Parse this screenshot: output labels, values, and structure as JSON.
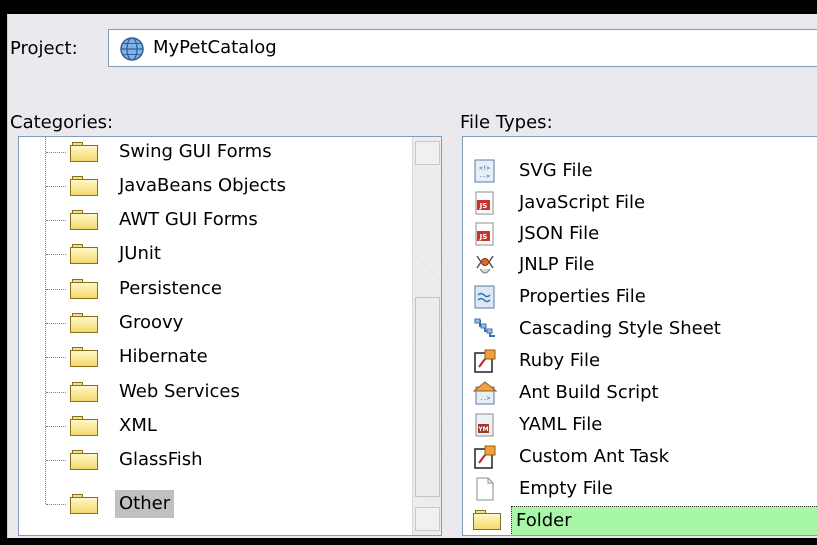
{
  "project": {
    "label": "Project:",
    "value": "MyPetCatalog",
    "icon": "globe-project-icon"
  },
  "categories": {
    "label": "Categories:",
    "items": [
      {
        "label": "Swing GUI Forms",
        "icon": "folder-icon"
      },
      {
        "label": "JavaBeans Objects",
        "icon": "folder-icon"
      },
      {
        "label": "AWT GUI Forms",
        "icon": "folder-icon"
      },
      {
        "label": "JUnit",
        "icon": "folder-icon"
      },
      {
        "label": "Persistence",
        "icon": "folder-icon"
      },
      {
        "label": "Groovy",
        "icon": "folder-icon"
      },
      {
        "label": "Hibernate",
        "icon": "folder-icon"
      },
      {
        "label": "Web Services",
        "icon": "folder-icon"
      },
      {
        "label": "XML",
        "icon": "folder-icon"
      },
      {
        "label": "GlassFish",
        "icon": "folder-icon"
      },
      {
        "label": "Other",
        "icon": "folder-icon",
        "selected": true
      }
    ]
  },
  "file_types": {
    "label": "File Types:",
    "items": [
      {
        "label": "SVG File",
        "icon": "svg-file-icon"
      },
      {
        "label": "JavaScript File",
        "icon": "javascript-file-icon"
      },
      {
        "label": "JSON File",
        "icon": "json-file-icon"
      },
      {
        "label": "JNLP File",
        "icon": "jnlp-file-icon"
      },
      {
        "label": "Properties File",
        "icon": "properties-file-icon"
      },
      {
        "label": "Cascading Style Sheet",
        "icon": "css-file-icon"
      },
      {
        "label": "Ruby File",
        "icon": "ruby-file-icon"
      },
      {
        "label": "Ant Build Script",
        "icon": "ant-build-script-icon"
      },
      {
        "label": "YAML File",
        "icon": "yaml-file-icon"
      },
      {
        "label": "Custom Ant Task",
        "icon": "custom-ant-task-icon"
      },
      {
        "label": "Empty File",
        "icon": "empty-file-icon"
      },
      {
        "label": "Folder",
        "icon": "folder-icon",
        "selected": true
      }
    ]
  },
  "colors": {
    "selection_green": "#a8f7a8",
    "selection_gray": "#c0c0c0",
    "panel_bg": "#ebe9ed",
    "list_border": "#7f9db9"
  }
}
